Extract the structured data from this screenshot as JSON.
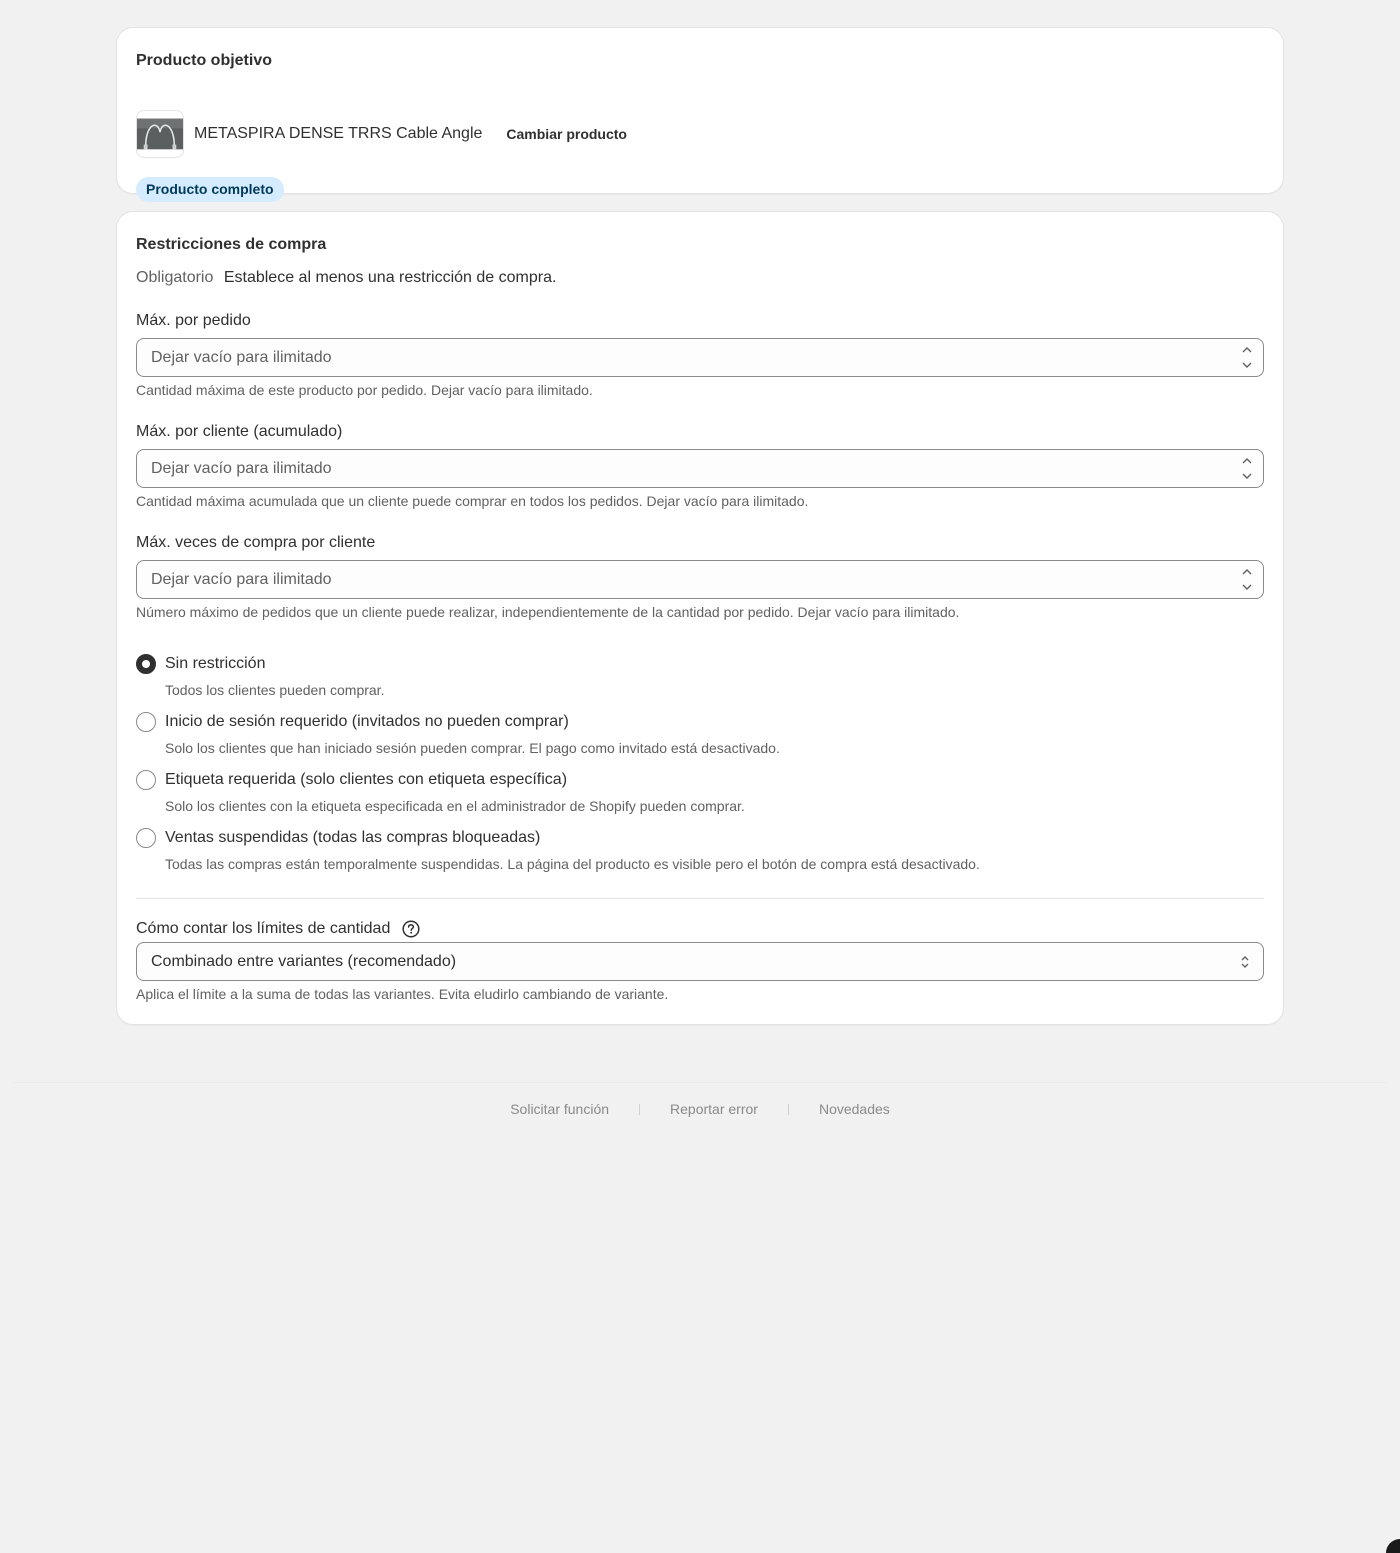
{
  "target_product": {
    "title": "Producto objetivo",
    "product_name": "METASPIRA DENSE TRRS Cable Angle",
    "change_button": "Cambiar producto",
    "scope_badge": "Producto completo"
  },
  "restrictions": {
    "title": "Restricciones de compra",
    "required_label": "Obligatorio",
    "required_text": "Establece al menos una restricción de compra.",
    "fields": [
      {
        "label": "Máx. por pedido",
        "placeholder": "Dejar vacío para ilimitado",
        "help": "Cantidad máxima de este producto por pedido. Dejar vacío para ilimitado."
      },
      {
        "label": "Máx. por cliente (acumulado)",
        "placeholder": "Dejar vacío para ilimitado",
        "help": "Cantidad máxima acumulada que un cliente puede comprar en todos los pedidos. Dejar vacío para ilimitado."
      },
      {
        "label": "Máx. veces de compra por cliente",
        "placeholder": "Dejar vacío para ilimitado",
        "help": "Número máximo de pedidos que un cliente puede realizar, independientemente de la cantidad por pedido. Dejar vacío para ilimitado."
      }
    ],
    "access_options": [
      {
        "label": "Sin restricción",
        "help": "Todos los clientes pueden comprar.",
        "checked": true
      },
      {
        "label": "Inicio de sesión requerido (invitados no pueden comprar)",
        "help": "Solo los clientes que han iniciado sesión pueden comprar. El pago como invitado está desactivado.",
        "checked": false
      },
      {
        "label": "Etiqueta requerida (solo clientes con etiqueta específica)",
        "help": "Solo los clientes con la etiqueta especificada en el administrador de Shopify pueden comprar.",
        "checked": false
      },
      {
        "label": "Ventas suspendidas (todas las compras bloqueadas)",
        "help": "Todas las compras están temporalmente suspendidas. La página del producto es visible pero el botón de compra está desactivado.",
        "checked": false
      }
    ],
    "count_mode": {
      "label": "Cómo contar los límites de cantidad",
      "selected": "Combinado entre variantes (recomendado)",
      "help": "Aplica el límite a la suma de todas las variantes. Evita eludirlo cambiando de variante."
    }
  },
  "footer": {
    "links": [
      "Solicitar función",
      "Reportar error",
      "Novedades"
    ]
  },
  "colors": {
    "page_bg": "#f1f1f1",
    "card_bg": "#ffffff",
    "badge_bg": "#d5ebff",
    "badge_text": "#003a5a",
    "text": "#303030",
    "muted": "#616161"
  }
}
